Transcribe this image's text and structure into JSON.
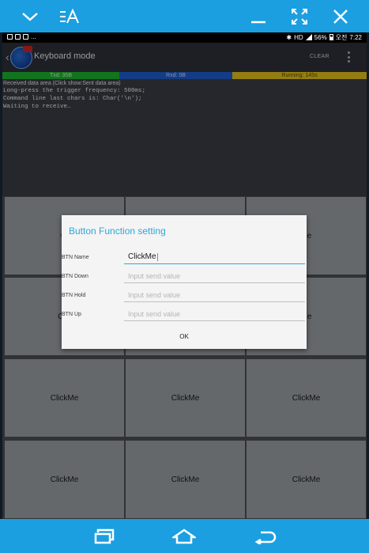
{
  "window": {
    "icons": [
      "chevron-down-icon",
      "keyboard-input-icon",
      "minimize-icon",
      "fullscreen-icon",
      "close-icon"
    ]
  },
  "status_bar": {
    "left_text": "...",
    "right": {
      "network": "HD",
      "battery": "56%",
      "period": "오전",
      "time": "7:22"
    }
  },
  "app": {
    "title": "Keyboard mode",
    "clear_label": "CLEAR"
  },
  "stats": {
    "tx": "Txd: 35B",
    "rx": "Rxd: 0B",
    "running": "Running: 145s"
  },
  "log": {
    "header": "Received data area  (Click show:Sent data area)",
    "lines": [
      "Long-press the trigger frequency: 500ms;",
      "Command line last chars is: Char('\\n');",
      "Waiting to receive…"
    ]
  },
  "grid": {
    "buttons": [
      {
        "label": "Cl"
      },
      {
        "label": ""
      },
      {
        "label": "gle"
      },
      {
        "label": "Clic"
      },
      {
        "label": ""
      },
      {
        "label": "Me"
      },
      {
        "label": "ClickMe"
      },
      {
        "label": "ClickMe"
      },
      {
        "label": "ClickMe"
      },
      {
        "label": "ClickMe"
      },
      {
        "label": "ClickMe"
      },
      {
        "label": "ClickMe"
      }
    ]
  },
  "dialog": {
    "title": "Button Function setting",
    "fields": [
      {
        "label": "BTN Name",
        "value": "ClickMe",
        "placeholder": ""
      },
      {
        "label": "BTN Down",
        "value": "",
        "placeholder": "Input send value"
      },
      {
        "label": "BTN Hold",
        "value": "",
        "placeholder": "Input send value"
      },
      {
        "label": "BTN Up",
        "value": "",
        "placeholder": "Input send value"
      }
    ],
    "ok_label": "OK"
  },
  "nav": {
    "icons": [
      "recent-apps-icon",
      "home-icon",
      "back-icon"
    ]
  },
  "colors": {
    "accent": "#1b9fe0",
    "dialog_title": "#2fa7d6",
    "tx": "#1db22f",
    "rx": "#1e5fd0",
    "running": "#e4c21c"
  }
}
